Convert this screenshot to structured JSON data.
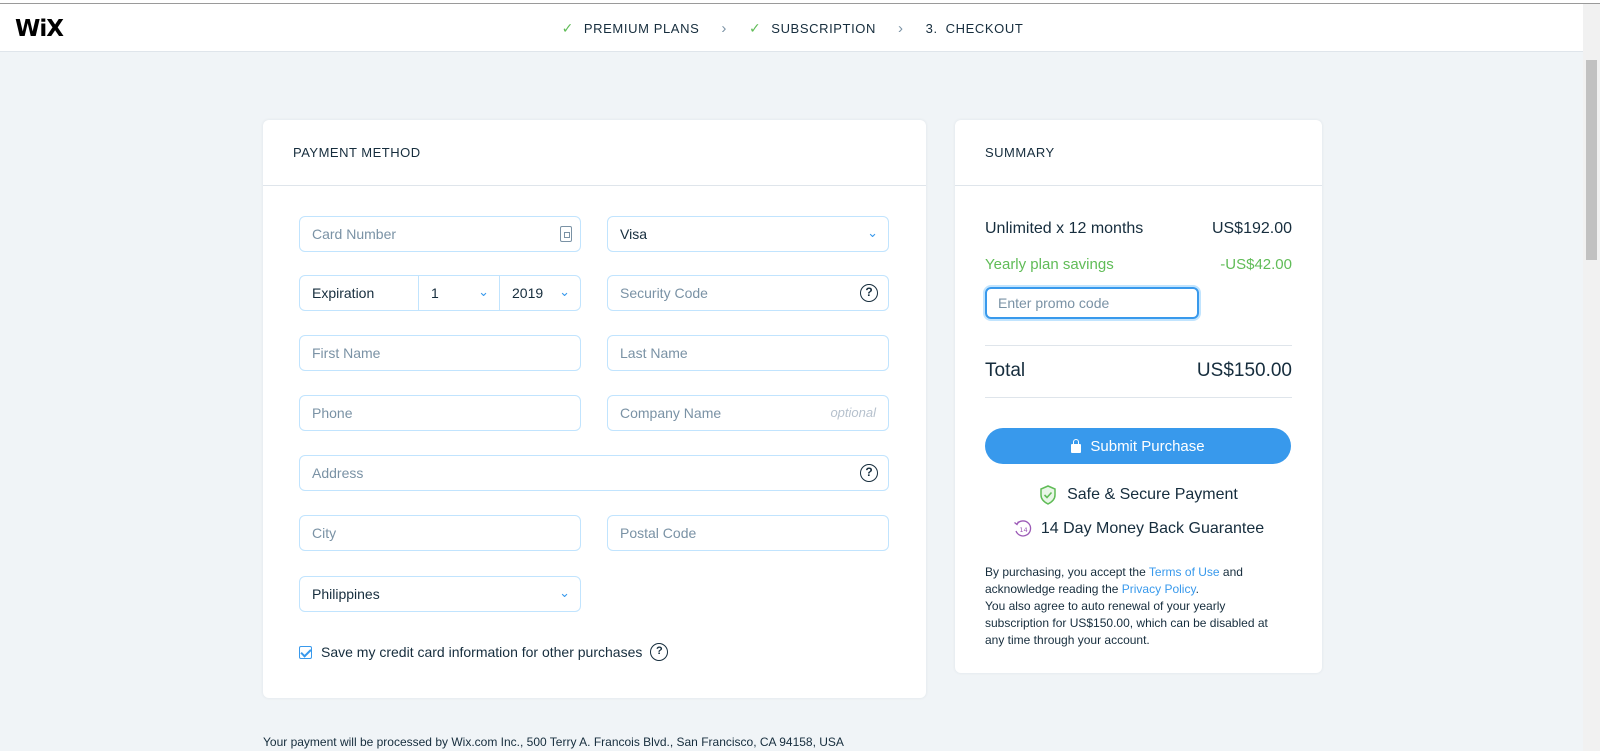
{
  "header": {
    "logo": "WiX",
    "steps": [
      {
        "label": "PREMIUM PLANS",
        "done": true
      },
      {
        "label": "SUBSCRIPTION",
        "done": true
      },
      {
        "number": "3.",
        "label": "CHECKOUT",
        "done": false
      }
    ],
    "check_glyph": "✓",
    "sep_glyph": "›"
  },
  "payment": {
    "title": "PAYMENT METHOD",
    "card_number_placeholder": "Card Number",
    "card_type": "Visa",
    "expiration_label": "Expiration",
    "exp_month": "1",
    "exp_year": "2019",
    "security_code_placeholder": "Security Code",
    "first_name_placeholder": "First Name",
    "last_name_placeholder": "Last Name",
    "phone_placeholder": "Phone",
    "company_placeholder": "Company Name",
    "optional_label": "optional",
    "address_placeholder": "Address",
    "city_placeholder": "City",
    "postal_placeholder": "Postal Code",
    "country": "Philippines",
    "save_card_label": "Save my credit card information for other purchases",
    "save_card_checked": true,
    "help_glyph": "?"
  },
  "summary": {
    "title": "SUMMARY",
    "line_item_label": "Unlimited x 12 months",
    "line_item_price": "US$192.00",
    "savings_label": "Yearly plan savings",
    "savings_amount": "-US$42.00",
    "promo_placeholder": "Enter promo code",
    "total_label": "Total",
    "total_amount": "US$150.00",
    "submit_label": "Submit Purchase",
    "secure_label": "Safe & Secure Payment",
    "guarantee_label": "14 Day Money Back Guarantee",
    "guarantee_days": "14",
    "legal_1": "By purchasing, you accept the ",
    "terms_link": "Terms of Use",
    "legal_2": " and acknowledge reading the ",
    "privacy_link": "Privacy Policy",
    "legal_3": ".",
    "legal_4": "You also agree to auto renewal of your yearly subscription for US$150.00, which can be disabled at any time through your account."
  },
  "footer": {
    "processor_text": "Your payment will be processed by Wix.com Inc., 500 Terry A. Francois Blvd., San Francisco, CA 94158, USA"
  },
  "colors": {
    "accent": "#3899ec",
    "success": "#60bc57",
    "text": "#162d3d",
    "background": "#f0f4f7"
  }
}
